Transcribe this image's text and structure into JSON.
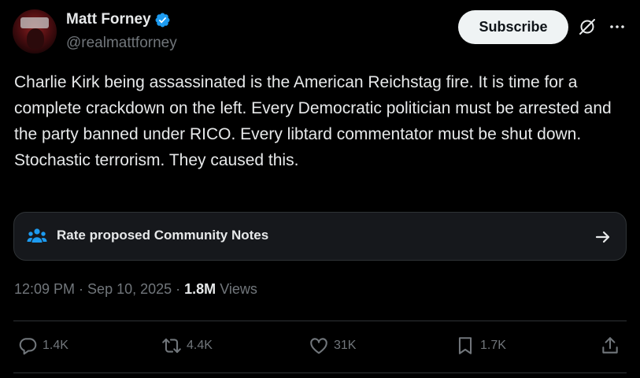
{
  "author": {
    "display_name": "Matt Forney",
    "handle": "@realmattforney",
    "verified": true
  },
  "header": {
    "subscribe_label": "Subscribe",
    "grok_icon": "grok-icon",
    "more_icon": "more-icon"
  },
  "tweet": {
    "text": "Charlie Kirk being assassinated is the American Reichstag fire. It is time for a complete crackdown on the left. Every Democratic politician must be arrested and the party banned under RICO. Every libtard commentator must be shut down. Stochastic terrorism. They caused this."
  },
  "community_notes": {
    "label": "Rate proposed Community Notes",
    "icon": "people-icon",
    "arrow_icon": "arrow-right-icon"
  },
  "meta": {
    "time": "12:09 PM",
    "separator": " · ",
    "date": "Sep 10, 2025",
    "views_count": "1.8M",
    "views_label": " Views"
  },
  "actions": {
    "replies": "1.4K",
    "reposts": "4.4K",
    "likes": "31K",
    "bookmarks": "1.7K"
  },
  "colors": {
    "background": "#000000",
    "text_primary": "#e7e9ea",
    "text_secondary": "#71767b",
    "verified_blue": "#1d9bf0",
    "notes_icon_blue": "#1d9bf0",
    "border": "#2f3336"
  }
}
